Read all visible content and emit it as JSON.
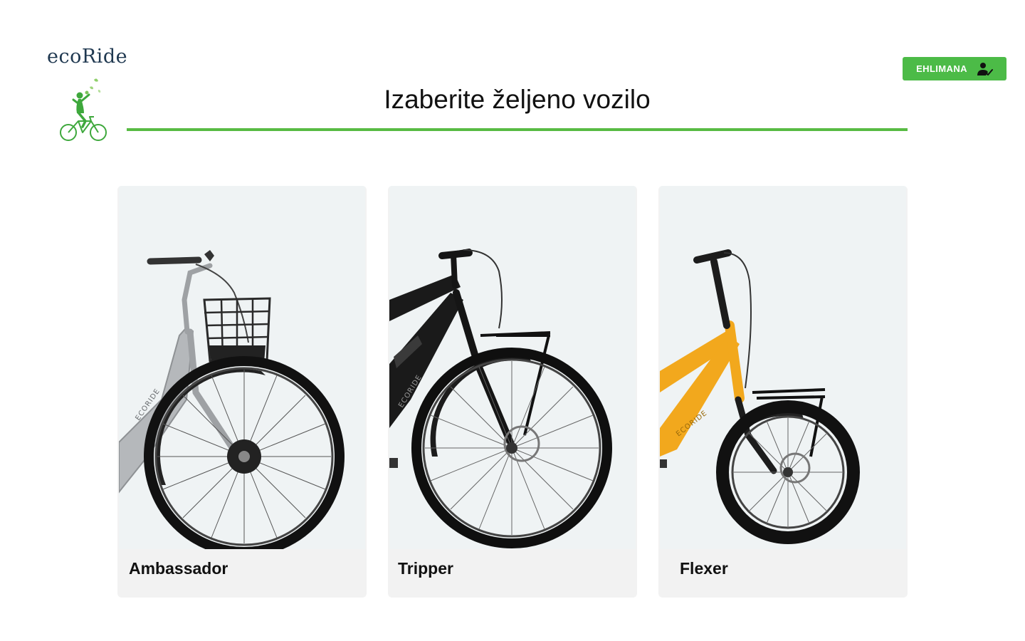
{
  "brand": {
    "name": "ecoRide",
    "emblem_icon": "cyclist-logo-icon"
  },
  "header": {
    "title": "Izaberite željeno vozilo",
    "accent_color": "#58bb43"
  },
  "login": {
    "label": "EHLIMANA",
    "icon": "user-check-icon",
    "color": "#4cbb47"
  },
  "vehicles": [
    {
      "name": "Ambassador",
      "color": "silver",
      "frame_text": "ECORIDE",
      "image_icon": "city-ebike-with-basket-image"
    },
    {
      "name": "Tripper",
      "color": "black",
      "frame_text": "ECORIDE",
      "image_icon": "trekking-ebike-image"
    },
    {
      "name": "Flexer",
      "color": "yellow",
      "frame_text": "ECORIDE",
      "image_icon": "compact-ebike-image"
    }
  ]
}
